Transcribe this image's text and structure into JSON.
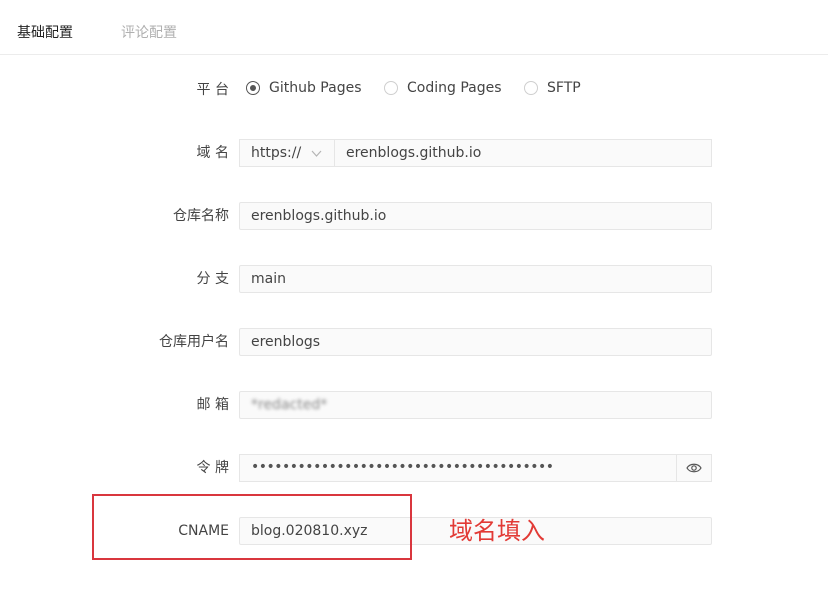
{
  "tabs": {
    "basic": "基础配置",
    "comment": "评论配置"
  },
  "platform": {
    "label": "平 台",
    "options": [
      "Github Pages",
      "Coding Pages",
      "SFTP"
    ],
    "selected": "Github Pages"
  },
  "domain": {
    "label": "域 名",
    "protocol": "https://",
    "value": "erenblogs.github.io"
  },
  "repo_name": {
    "label": "仓库名称",
    "value": "erenblogs.github.io"
  },
  "branch": {
    "label": "分 支",
    "value": "main"
  },
  "repo_user": {
    "label": "仓库用户名",
    "value": "erenblogs"
  },
  "email": {
    "label": "邮 箱",
    "value": "*redacted*"
  },
  "token": {
    "label": "令 牌",
    "masked_value": "•••••••••••••••••••••••••••••••••••••••"
  },
  "cname": {
    "label": "CNAME",
    "value": "blog.020810.xyz"
  },
  "annotation": {
    "text": "域名填入",
    "color": "#e23a35"
  }
}
